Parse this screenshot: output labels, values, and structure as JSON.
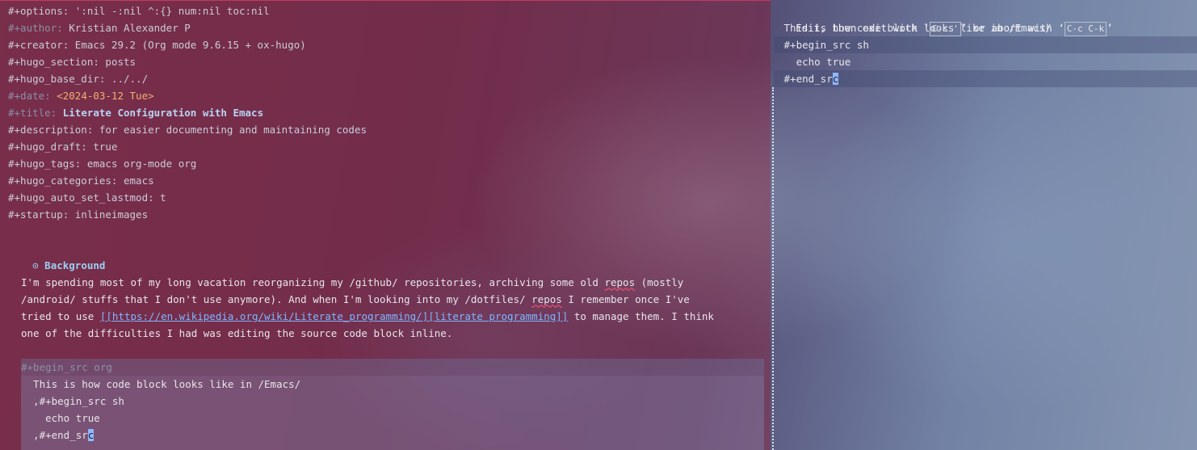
{
  "left_buffer": {
    "front_matter": [
      {
        "key": "#+options:",
        "value": " ':nil -:nil ^:{} num:nil toc:nil",
        "style": "val",
        "key_style": "val"
      },
      {
        "key": "#+author:",
        "value": " Kristian Alexander P",
        "style": "val",
        "key_style": "kw"
      },
      {
        "key": "#+creator:",
        "value": " Emacs 29.2 (Org mode 9.6.15 + ox-hugo)",
        "style": "val",
        "key_style": "val"
      },
      {
        "key": "#+hugo_section:",
        "value": " posts",
        "style": "val",
        "key_style": "val"
      },
      {
        "key": "#+hugo_base_dir:",
        "value": " ../../",
        "style": "val",
        "key_style": "val"
      },
      {
        "key": "#+date:",
        "value": " <2024-03-12 Tue>",
        "style": "date",
        "key_style": "kw"
      },
      {
        "key": "#+title:",
        "value": " Literate Configuration with Emacs",
        "style": "title-val",
        "key_style": "kw"
      },
      {
        "key": "#+description:",
        "value": " for easier documenting and maintaining codes",
        "style": "val",
        "key_style": "val"
      },
      {
        "key": "#+hugo_draft:",
        "value": " true",
        "style": "val",
        "key_style": "val"
      },
      {
        "key": "#+hugo_tags:",
        "value": " emacs org-mode org",
        "style": "val",
        "key_style": "val"
      },
      {
        "key": "#+hugo_categories:",
        "value": " emacs",
        "style": "val",
        "key_style": "val"
      },
      {
        "key": "#+hugo_auto_set_lastmod:",
        "value": " t",
        "style": "val",
        "key_style": "val"
      },
      {
        "key": "#+startup:",
        "value": " inlineimages",
        "style": "val",
        "key_style": "val"
      }
    ],
    "heading": {
      "bullet": "⊙",
      "text": "Background"
    },
    "paragraph": {
      "l1_a": "I'm spending most of my long vacation reorganizing my /github/ repositories, archiving some old ",
      "l1_b": "repos",
      "l1_c": " (mostly",
      "l2_a": "/android/ stuffs that I don't use anymore). And when I'm looking into my /dotfiles/ ",
      "l2_b": "repos",
      "l2_c": " I remember once I've",
      "l3_a": "tried to use ",
      "l3_link": "[[https://en.wikipedia.org/wiki/Literate_programming/][literate programming]]",
      "l3_c": " to manage them. I think",
      "l4": "one of the difficulties I had was editing the source code block inline."
    },
    "src_block": {
      "begin": "#+begin_src org",
      "lines": [
        "  This is how code block looks like in /Emacs/",
        "  ,#+begin_src sh",
        "    echo true"
      ],
      "last_before_cursor": "  ,#+end_sr",
      "cursor_char": "c"
    }
  },
  "right_buffer": {
    "message": {
      "prefix": "Edit, then exit with ‘",
      "exit_key": "C-c '",
      "middle": "’ or abort with ‘",
      "abort_key": "C-c C-k",
      "suffix": "’"
    },
    "lines": [
      {
        "text": " This is how code block looks like in /Emacs/",
        "style": "body"
      },
      {
        "text": " #+begin_src sh",
        "style": "kw"
      },
      {
        "text": "   echo true",
        "style": "body"
      }
    ],
    "end_before_cursor": " #+end_sr",
    "cursor_char": "c"
  }
}
